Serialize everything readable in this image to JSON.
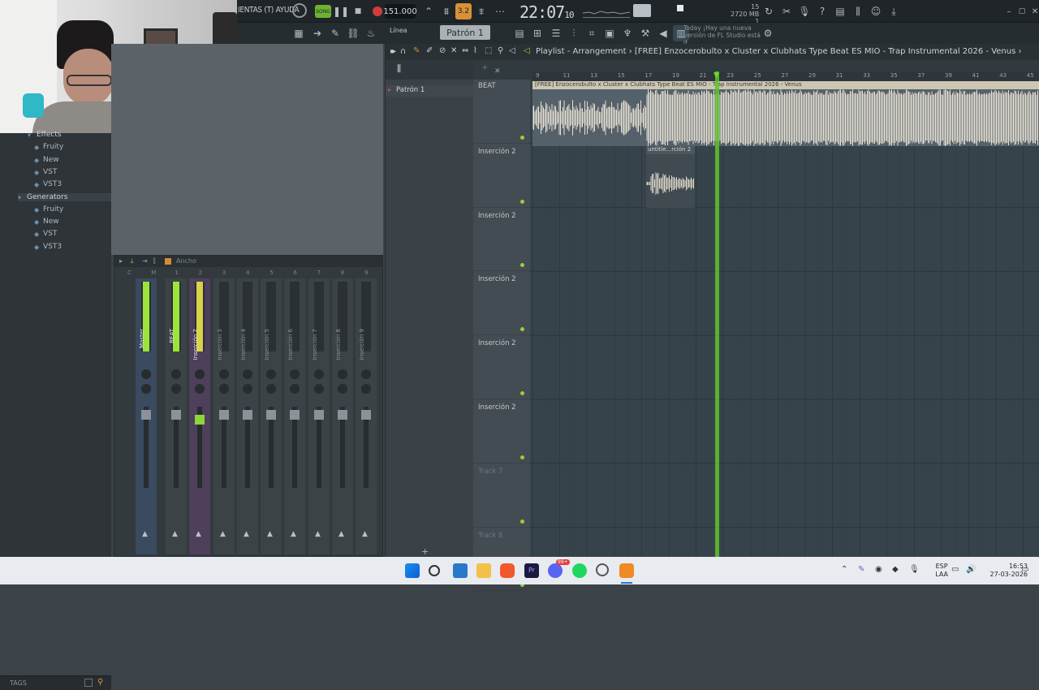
{
  "topbar": {
    "menu_text": "IENTAS (T) AYUDA",
    "song_label": "SONG",
    "tempo": "151.000",
    "clock_main": "22:07",
    "clock_sub": "10",
    "mem_top": "15",
    "mem_mid": "2720 MB",
    "mem_bottom": "1"
  },
  "toolbar2": {
    "mode": "Línea",
    "pattern": "Patrón 1",
    "news_line1": "Today  ¡Hay una nueva",
    "news_line2": "versión de FL Studio está d.."
  },
  "browser": {
    "items": [
      {
        "label": "Effects",
        "kind": "folder"
      },
      {
        "label": "Fruity",
        "kind": "sub"
      },
      {
        "label": "New",
        "kind": "sub"
      },
      {
        "label": "VST",
        "kind": "sub"
      },
      {
        "label": "VST3",
        "kind": "sub"
      },
      {
        "label": "Generators",
        "kind": "folder"
      },
      {
        "label": "Fruity",
        "kind": "sub"
      },
      {
        "label": "New",
        "kind": "sub"
      },
      {
        "label": "VST",
        "kind": "sub"
      },
      {
        "label": "VST3",
        "kind": "sub"
      }
    ],
    "tags_label": "TAGS"
  },
  "mixer": {
    "header_label": "Ancho",
    "top_labels": [
      "C",
      "M",
      "1",
      "2",
      "3",
      "4",
      "5",
      "6",
      "7",
      "8",
      "9"
    ],
    "strips": [
      "Master",
      "BEAT",
      "Inserción 2",
      "Inserción 3",
      "Inserción 4",
      "Inserción 5",
      "Inserción 6",
      "Inserción 7",
      "Inserción 8",
      "Inserción 9"
    ]
  },
  "rack": {
    "pattern_item": "Patrón 1"
  },
  "playlist": {
    "window_title": "Playlist - Arrangement",
    "arrangement_name": "[FREE] Enzocerobulto x Cluster x Clubhats Type Beat ES MIO - Trap Instrumental 2026 - Venus",
    "clip_header": "[FREE] Enzocerobulto x Cluster x Clubhats Type Beat ES MIO - Trap Instrumental 2026 - Venus",
    "clip2_label": "untitle...rción 2",
    "tracks": [
      "BEAT",
      "Inserción 2",
      "Inserción 2",
      "Inserción 2",
      "Inserción 2",
      "Inserción 2",
      "Track 7",
      "Track 8"
    ],
    "ruler": [
      "9",
      "11",
      "13",
      "15",
      "17",
      "19",
      "21",
      "23",
      "25",
      "27",
      "29",
      "31",
      "33",
      "35",
      "37",
      "39",
      "41",
      "43",
      "45"
    ]
  },
  "taskbar": {
    "lang_top": "ESP",
    "lang_bottom": "LAA",
    "time": "16:53",
    "date": "27-03-2026",
    "discord_badge": "99+"
  },
  "colors": {
    "accent_green": "#9be53b",
    "playhead": "#6fdc2e",
    "wave": "#e6e0d2",
    "mixer_yellow": "#d9d34a"
  }
}
